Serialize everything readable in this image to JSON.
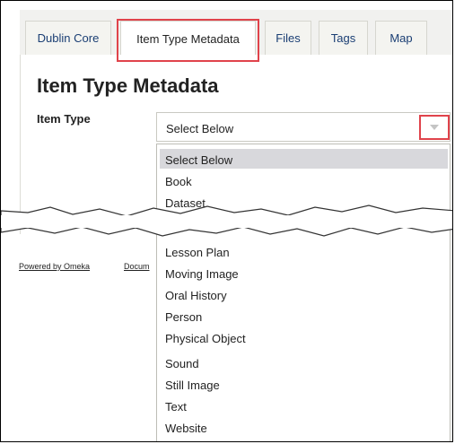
{
  "tabs": [
    {
      "label": "Dublin Core"
    },
    {
      "label": "Item Type Metadata"
    },
    {
      "label": "Files"
    },
    {
      "label": "Tags"
    },
    {
      "label": "Map"
    }
  ],
  "page_title": "Item Type Metadata",
  "field_label": "Item Type",
  "select": {
    "value": "Select Below"
  },
  "dropdown": {
    "options_top": [
      "Select Below",
      "Book",
      "Dataset"
    ],
    "options_bottom": [
      "Lesson Plan",
      "Moving Image",
      "Oral History",
      "Person",
      "Physical Object",
      "Sound",
      "Still Image",
      "Text",
      "Website"
    ]
  },
  "footer": {
    "powered_by": "Powered by Omeka",
    "documentation": "Docum"
  },
  "colors": {
    "highlight": "#e0434b",
    "tab_text": "#1a3e73",
    "selected_option_bg": "#d8d8dc"
  }
}
